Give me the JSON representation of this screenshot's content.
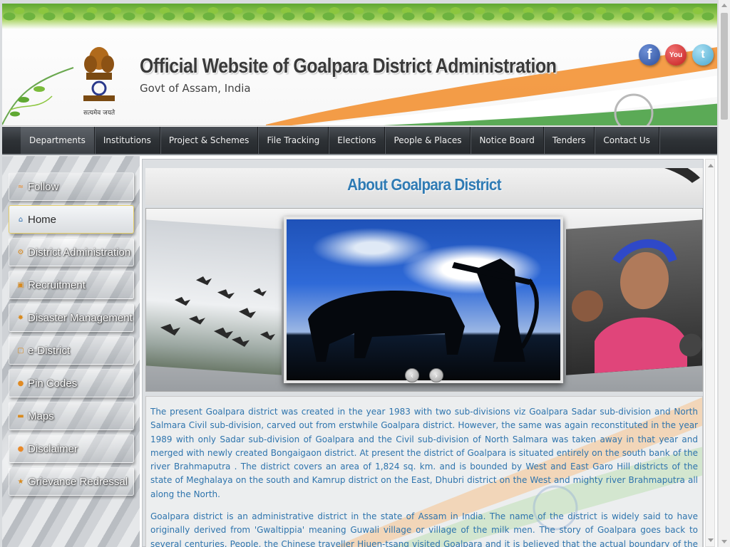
{
  "header": {
    "title": "Official Website of Goalpara District Administration",
    "subtitle": "Govt of Assam, India",
    "emblem_caption": "सत्यमेव जयते",
    "social": [
      {
        "name": "facebook-icon",
        "glyph": "f"
      },
      {
        "name": "youtube-icon",
        "glyph": "You"
      },
      {
        "name": "twitter-icon",
        "glyph": "t"
      }
    ]
  },
  "nav": {
    "items": [
      "Departments",
      "Institutions",
      "Project & Schemes",
      "File Tracking",
      "Elections",
      "People & Places",
      "Notice Board",
      "Tenders",
      "Contact Us"
    ]
  },
  "sidebar": {
    "items": [
      {
        "label": "Follow",
        "icon": "rss-icon",
        "glyph": "≈",
        "color": "#e8892a"
      },
      {
        "label": "Home",
        "icon": "home-icon",
        "glyph": "⌂",
        "color": "#2f6fb0"
      },
      {
        "label": "District Administration",
        "icon": "gear-icon",
        "glyph": "⚙",
        "color": "#d88a1e"
      },
      {
        "label": "Recruitment",
        "icon": "briefcase-icon",
        "glyph": "▣",
        "color": "#d88a1e"
      },
      {
        "label": "Disaster Management",
        "icon": "warning-icon",
        "glyph": "✸",
        "color": "#d88a1e"
      },
      {
        "label": "e-District",
        "icon": "monitor-icon",
        "glyph": "▢",
        "color": "#d88a1e"
      },
      {
        "label": "Pin Codes",
        "icon": "map-pin-icon",
        "glyph": "●",
        "color": "#e08a22"
      },
      {
        "label": "Maps",
        "icon": "map-icon",
        "glyph": "▬",
        "color": "#d88a1e"
      },
      {
        "label": "Disclaimer",
        "icon": "info-icon",
        "glyph": "●",
        "color": "#e8892a"
      },
      {
        "label": "Grievance Redressal",
        "icon": "star-icon",
        "glyph": "★",
        "color": "#d88a1e"
      }
    ]
  },
  "main": {
    "heading": "About Goalpara District",
    "carousel": {
      "prev_glyph": "‹",
      "next_glyph": "›"
    },
    "paragraphs": [
      "The present Goalpara district was created in the year 1983 with two sub-divisions viz Goalpara Sadar sub-division and North Salmara Civil sub-division, carved out from erstwhile Goalpara district. However, the same was again reconstituted in the year 1989 with only Sadar sub-division of Goalpara and the Civil sub-division of North Salmara was taken away in that year and merged with newly created Bongaigaon district. At present the district of Goalpara is situated entirely on the south bank of the river Brahmaputra . The district covers an area of 1,824 sq. km. and is bounded by West and East Garo Hill districts of the state of Meghalaya on the south and Kamrup district on the East, Dhubri district on the West and mighty river Brahmaputra all along the North.",
      "Goalpara district is an administrative district in the state of Assam in India. The name of the district is widely said to have originally derived from 'Gwaltippia' meaning Guwali village or village of the milk men. The story of Goalpara goes back to several centuries. People, the Chinese traveller Hiuen-tsang visited Goalpara and it is believed that the actual boundary of the kingdom of"
    ]
  },
  "colors": {
    "accent": "#2f7bb4",
    "nav_bg": "#2e3236",
    "content_text": "#2e74ad"
  }
}
